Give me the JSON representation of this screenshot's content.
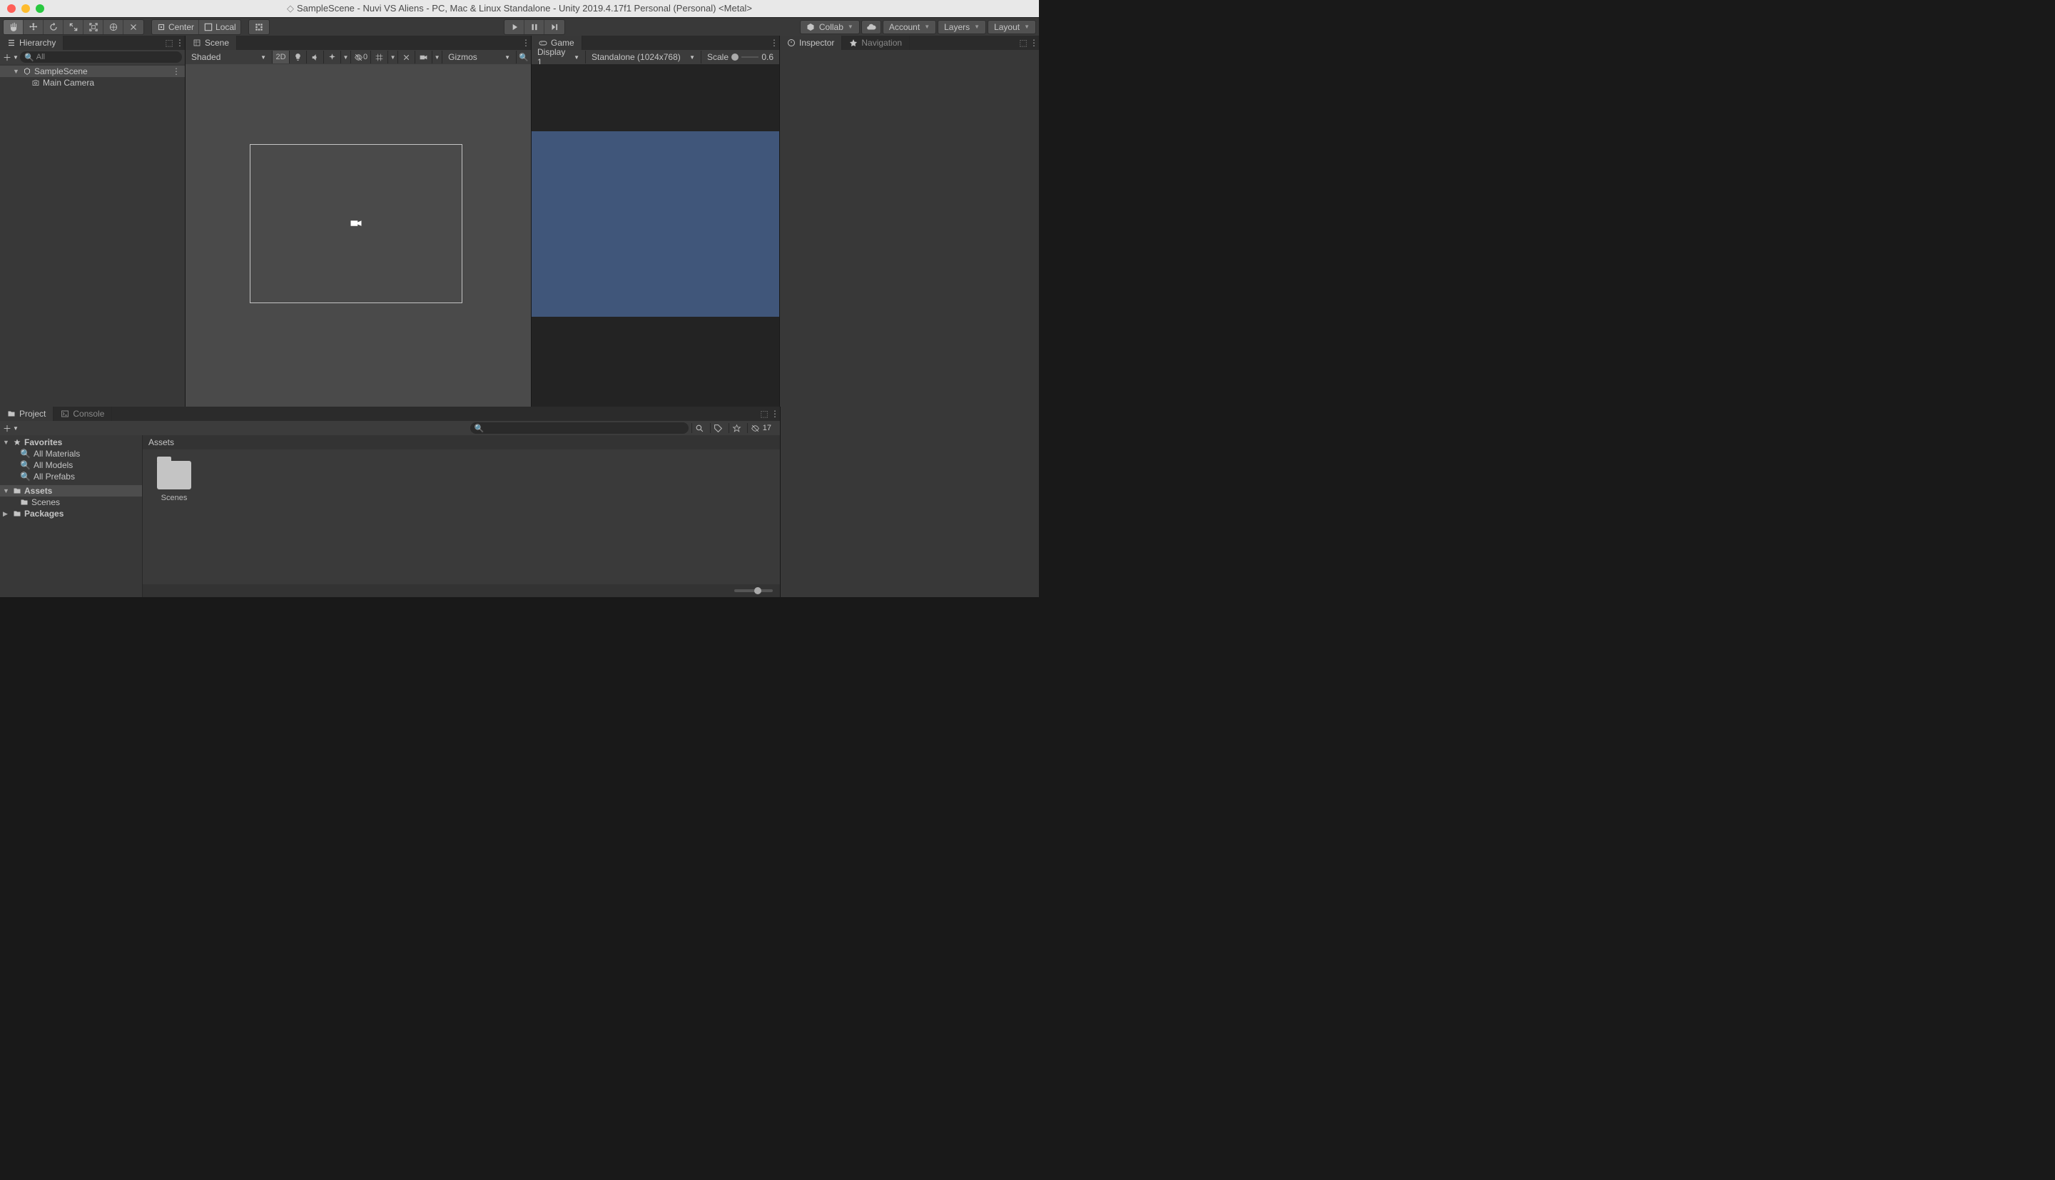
{
  "window": {
    "title": "SampleScene - Nuvi VS Aliens - PC, Mac & Linux Standalone - Unity 2019.4.17f1 Personal (Personal) <Metal>"
  },
  "toolbar": {
    "pivot": "Center",
    "space": "Local",
    "collab": "Collab",
    "account": "Account",
    "layers": "Layers",
    "layout": "Layout"
  },
  "hierarchy": {
    "title": "Hierarchy",
    "search_placeholder": "All",
    "items": [
      {
        "label": "SampleScene",
        "icon": "scene",
        "depth": 0,
        "selected": true,
        "expandable": true
      },
      {
        "label": "Main Camera",
        "icon": "camera",
        "depth": 1,
        "selected": false,
        "expandable": false
      }
    ]
  },
  "scene": {
    "title": "Scene",
    "shading": "Shaded",
    "twoD": "2D",
    "gizmos": "Gizmos",
    "hiddenCount": "0"
  },
  "game": {
    "title": "Game",
    "display": "Display 1",
    "resolution": "Standalone (1024x768)",
    "scaleLabel": "Scale",
    "scaleValue": "0.6"
  },
  "inspector": {
    "title": "Inspector"
  },
  "navigation": {
    "title": "Navigation"
  },
  "project": {
    "tabProject": "Project",
    "tabConsole": "Console",
    "hiddenCount": "17",
    "favorites": {
      "label": "Favorites",
      "items": [
        "All Materials",
        "All Models",
        "All Prefabs"
      ]
    },
    "assets": {
      "label": "Assets",
      "children": [
        "Scenes"
      ]
    },
    "packages": {
      "label": "Packages"
    },
    "breadcrumb": "Assets",
    "gridItems": [
      {
        "name": "Scenes",
        "type": "folder"
      }
    ]
  }
}
